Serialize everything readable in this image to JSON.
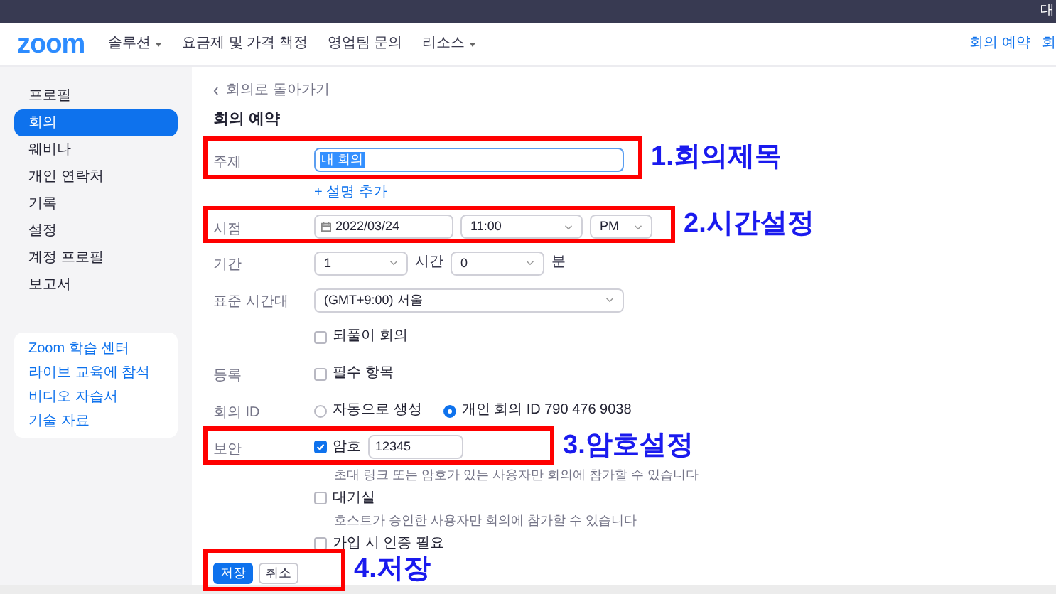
{
  "top_bar": {
    "text": "대"
  },
  "nav": {
    "logo": "zoom",
    "items": [
      {
        "label": "솔루션",
        "dropdown": true
      },
      {
        "label": "요금제 및 가격 책정",
        "dropdown": false
      },
      {
        "label": "영업팀 문의",
        "dropdown": false
      },
      {
        "label": "리소스",
        "dropdown": true
      }
    ],
    "right": [
      "회의 예약",
      "회"
    ]
  },
  "sidebar": {
    "items": [
      {
        "label": "프로필",
        "selected": false
      },
      {
        "label": "회의",
        "selected": true
      },
      {
        "label": "웨비나",
        "selected": false
      },
      {
        "label": "개인 연락처",
        "selected": false
      },
      {
        "label": "기록",
        "selected": false
      },
      {
        "label": "설정",
        "selected": false
      },
      {
        "label": "계정 프로필",
        "selected": false
      },
      {
        "label": "보고서",
        "selected": false
      }
    ],
    "links": [
      "Zoom 학습 센터",
      "라이브 교육에 참석",
      "비디오 자습서",
      "기술 자료"
    ]
  },
  "back_link": "회의로 돌아가기",
  "title": "회의 예약",
  "rows": [
    {
      "kind": "subject",
      "label": "주제",
      "controls": [
        {
          "kind": "text_input",
          "value": "내 회의",
          "highlighted": true
        }
      ]
    },
    {
      "kind": "link",
      "controls": [
        {
          "kind": "link",
          "text": "+ 설명 추가"
        }
      ]
    },
    {
      "kind": "datetime",
      "label": "시점",
      "controls": [
        {
          "kind": "date",
          "value": "2022/03/24"
        },
        {
          "kind": "select",
          "value": "11:00"
        },
        {
          "kind": "select",
          "value": "PM"
        }
      ]
    },
    {
      "kind": "duration",
      "label": "기간",
      "controls": [
        {
          "kind": "select",
          "value": "1"
        },
        {
          "kind": "unit",
          "text": "시간"
        },
        {
          "kind": "select",
          "value": "0"
        },
        {
          "kind": "unit",
          "text": "분"
        }
      ]
    },
    {
      "kind": "timezone",
      "label": "표준 시간대",
      "controls": [
        {
          "kind": "select",
          "value": "(GMT+9:00) 서울"
        }
      ]
    },
    {
      "kind": "option",
      "controls": [
        {
          "kind": "checkbox",
          "text": "되풀이 회의",
          "checked": false
        }
      ]
    },
    {
      "kind": "option",
      "label": "등록",
      "controls": [
        {
          "kind": "checkbox",
          "text": "필수 항목",
          "checked": false
        }
      ]
    },
    {
      "kind": "option",
      "label": "회의 ID",
      "controls": [
        {
          "kind": "radio",
          "text": "자동으로 생성",
          "selected": false
        },
        {
          "kind": "radio",
          "text": "개인 회의 ID 790 476 9038",
          "selected": true
        }
      ]
    },
    {
      "kind": "security",
      "label": "보안",
      "controls": [
        {
          "kind": "checkbox",
          "text": "암호",
          "checked": true
        },
        {
          "kind": "text_input",
          "value": "12345",
          "highlighted": false
        }
      ]
    },
    {
      "kind": "hint",
      "controls": [
        {
          "kind": "hint",
          "text": "초대 링크 또는 암호가 있는 사용자만 회의에 참가할 수 있습니다"
        }
      ]
    },
    {
      "kind": "compact",
      "controls": [
        {
          "kind": "checkbox",
          "text": "대기실",
          "checked": false
        }
      ]
    },
    {
      "kind": "hint",
      "controls": [
        {
          "kind": "hint",
          "text": "호스트가 승인한 사용자만 회의에 참가할 수 있습니다"
        }
      ]
    },
    {
      "kind": "compact",
      "controls": [
        {
          "kind": "checkbox",
          "text": "가입 시 인증 필요",
          "checked": false
        }
      ]
    }
  ],
  "buttons": [
    {
      "label": "저장",
      "kind": "primary"
    },
    {
      "label": "취소",
      "kind": "secondary"
    }
  ],
  "annotations": [
    {
      "label": "1.회의제목"
    },
    {
      "label": "2.시간설정"
    },
    {
      "label": "3.암호설정"
    },
    {
      "label": "4.저장"
    }
  ]
}
